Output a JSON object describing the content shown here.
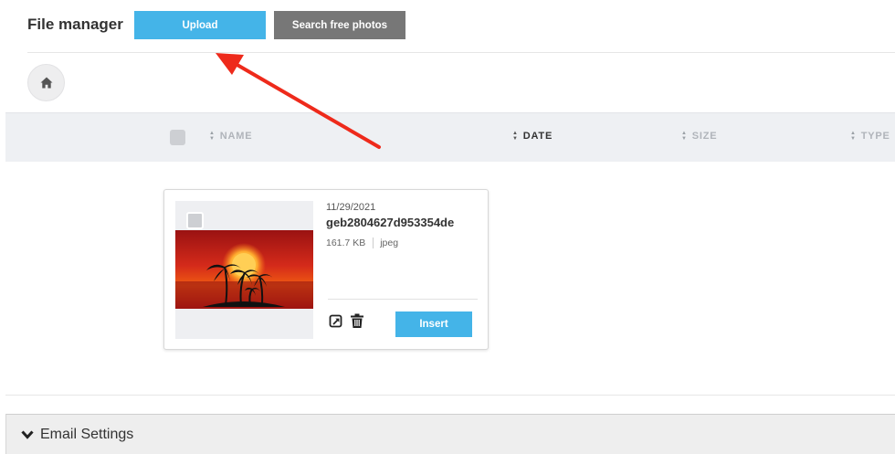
{
  "header": {
    "title": "File manager",
    "upload_label": "Upload",
    "search_photos_label": "Search free photos"
  },
  "table_header": {
    "columns": [
      {
        "label": "NAME",
        "active": false
      },
      {
        "label": "DATE",
        "active": true
      },
      {
        "label": "SIZE",
        "active": false
      },
      {
        "label": "TYPE",
        "active": false
      }
    ]
  },
  "file": {
    "date": "11/29/2021",
    "name": "geb2804627d953354de",
    "size": "161.7 KB",
    "type": "jpeg",
    "insert_label": "Insert"
  },
  "footer": {
    "label": "Email Settings"
  },
  "colors": {
    "primary": "#44b4e8",
    "secondary": "#777777",
    "annotation_arrow": "#ee2a1b"
  },
  "icons": [
    "home-icon",
    "sort-icon",
    "edit-icon",
    "trash-icon",
    "chevron-down-icon",
    "arrow-annotation"
  ]
}
